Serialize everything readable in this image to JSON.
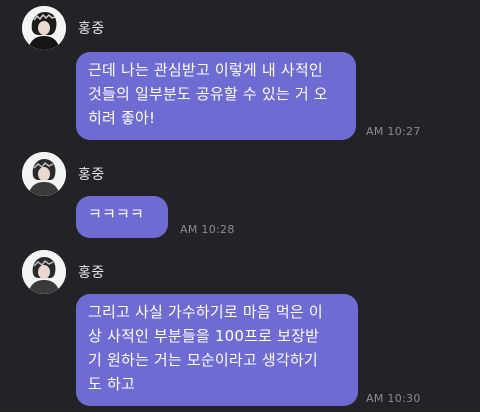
{
  "messages": [
    {
      "sender": "홍중",
      "avatar_icon": "profile-photo",
      "text": "근데 나는 관심받고 이렇게 내 사적인\n것들의 일부분도 공유할 수 있는 거 오\n히려 좋아!",
      "time": "AM 10:27"
    },
    {
      "sender": "홍중",
      "avatar_icon": "profile-photo",
      "text": "ㅋㅋㅋㅋ",
      "time": "AM 10:28"
    },
    {
      "sender": "홍중",
      "avatar_icon": "profile-photo",
      "text": "그리고 사실 가수하기로 마음 먹은 이\n상 사적인 부분들을 100프로 보장받\n기 원하는 거는 모순이라고 생각하기\n도 하고",
      "time": "AM 10:30"
    }
  ],
  "colors": {
    "background": "#232327",
    "bubble": "#6e6bd3",
    "bubble_text": "#ffffff",
    "sender_text": "#e6e6ea",
    "time_text": "#8a8a92"
  }
}
